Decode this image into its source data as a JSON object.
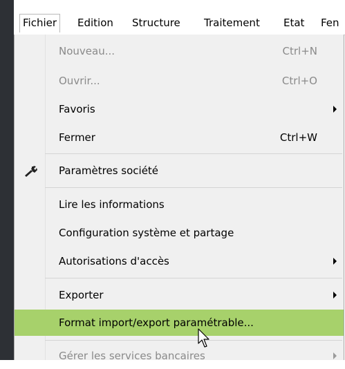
{
  "menubar": {
    "items": [
      "Fichier",
      "Edition",
      "Structure",
      "Traitement",
      "Etat",
      "Fen"
    ]
  },
  "menu": {
    "items": [
      {
        "label": "Nouveau...",
        "shortcut": "Ctrl+N",
        "disabled": true
      },
      {
        "label": "Ouvrir...",
        "shortcut": "Ctrl+O",
        "disabled": true
      },
      {
        "label": "Favoris",
        "submenu": true
      },
      {
        "label": "Fermer",
        "shortcut": "Ctrl+W"
      },
      {
        "label": "Paramètres société",
        "icon": "wrench-icon"
      },
      {
        "label": "Lire les informations"
      },
      {
        "label": "Configuration système et partage"
      },
      {
        "label": "Autorisations d'accès",
        "submenu": true
      },
      {
        "label": "Exporter",
        "submenu": true
      },
      {
        "label": "Format import/export paramétrable...",
        "highlighted": true
      },
      {
        "label": "Gérer les services bancaires",
        "submenu": true,
        "disabled": true
      }
    ]
  },
  "colors": {
    "highlight": "#a7d16b",
    "menu_background": "#f0f0f0",
    "disabled_text": "#8a8a8a",
    "left_panel": "#2d3035"
  }
}
